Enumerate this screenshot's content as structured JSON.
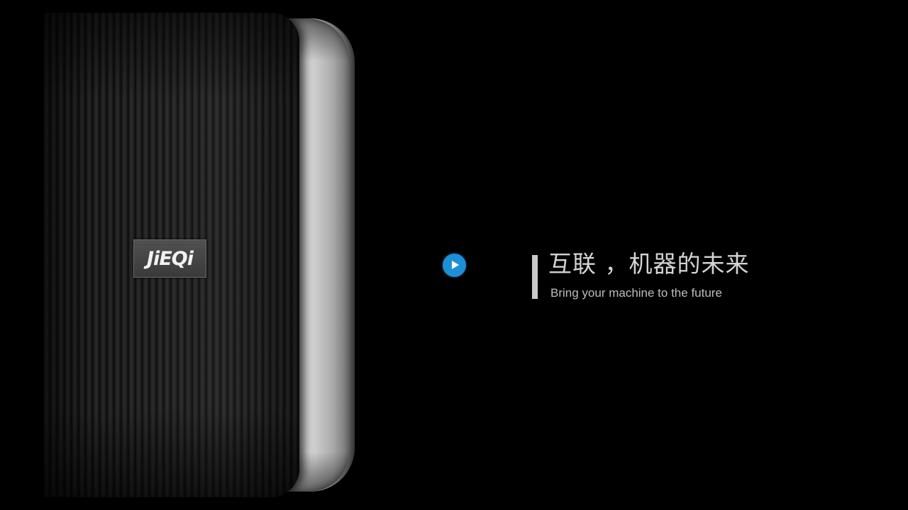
{
  "brand": {
    "logo_text": "JiEQi"
  },
  "slogan": {
    "title": "互联 ，机器的未来",
    "subtitle": "Bring your machine to the future"
  },
  "controls": {
    "play_icon": "play-icon"
  },
  "colors": {
    "background": "#000000",
    "accent": "#1d8fd6",
    "text": "#d4d4d4"
  }
}
